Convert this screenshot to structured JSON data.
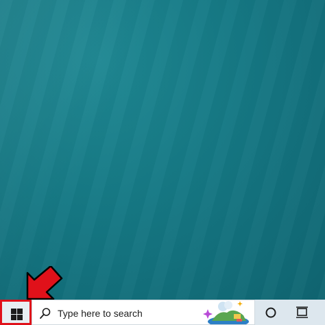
{
  "taskbar": {
    "start_button_label": "Start",
    "search": {
      "placeholder": "Type here to search"
    },
    "cortana_label": "Cortana",
    "task_view_label": "Task View"
  },
  "annotation": {
    "arrow_color": "#e0111a",
    "highlight_color": "#e0111a"
  },
  "colors": {
    "desktop": "#157884",
    "taskbar": "#dde7ee",
    "search_bg": "#ffffff"
  },
  "icons": [
    "windows-logo-icon",
    "search-icon",
    "cortana-icon",
    "task-view-icon",
    "search-highlight-illustration"
  ]
}
